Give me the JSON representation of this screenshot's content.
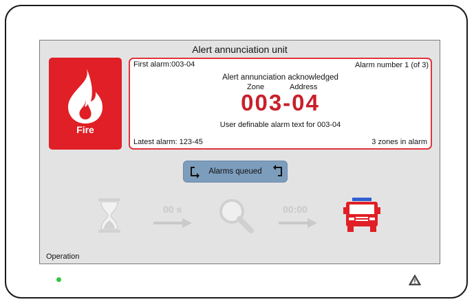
{
  "screen": {
    "title": "Alert annunciation unit",
    "status_label": "Operation"
  },
  "fire_tile": {
    "label": "Fire",
    "icon": "flame-icon",
    "color": "#e01f26"
  },
  "alarm": {
    "first_alarm": "First alarm:003-04",
    "alarm_number": "Alarm number 1 (of 3)",
    "status": "Alert annunciation acknowledged",
    "zone_label": "Zone",
    "address_label": "Address",
    "code": "003-04",
    "user_text": "User definable alarm text for 003-04",
    "latest_alarm": "Latest alarm: 123-45",
    "zones_in_alarm": "3 zones in alarm",
    "accent_color": "#c8202a"
  },
  "queue_button": {
    "label": "Alarms queued"
  },
  "sequence": {
    "delay_timer": "00 s",
    "investigation_timer": "00:00",
    "icons": [
      "hourglass-icon",
      "arrow-right-icon",
      "magnifier-icon",
      "arrow-right-icon",
      "fire-truck-icon"
    ]
  },
  "indicators": {
    "power_led_color": "#35c442",
    "warning_icon": "warning-triangle-icon"
  }
}
